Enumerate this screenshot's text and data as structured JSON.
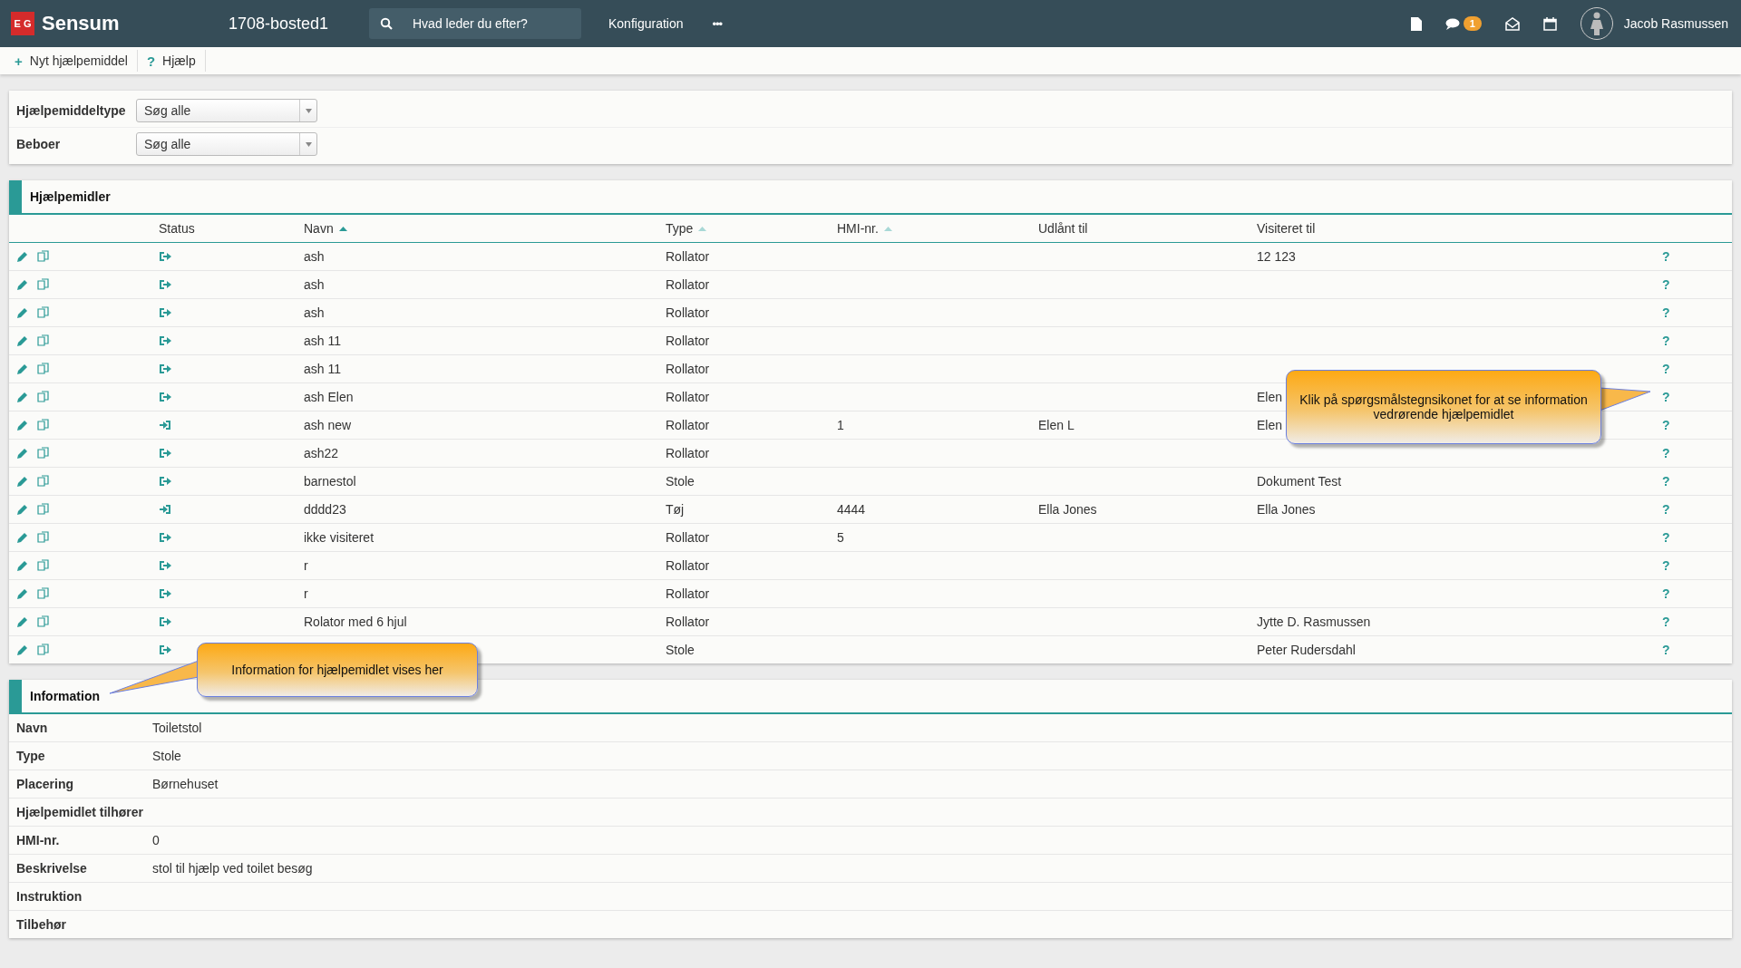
{
  "topbar": {
    "logo": "E G",
    "brand": "Sensum",
    "site": "1708-bosted1",
    "search": {
      "placeholder": "Hvad leder du efter?"
    },
    "menu": [
      "Konfiguration"
    ],
    "more": "•••",
    "chat_badge": "1",
    "user": "Jacob Rasmussen"
  },
  "toolbar": [
    {
      "icon": "+",
      "label": "Nyt hjælpemiddel"
    },
    {
      "icon": "?",
      "label": "Hjælp"
    }
  ],
  "filters": [
    {
      "label": "Hjælpemiddeltype",
      "value": "Søg alle"
    },
    {
      "label": "Beboer",
      "value": "Søg alle"
    }
  ],
  "aids": {
    "title": "Hjælpemidler",
    "columns": [
      {
        "label": "Status"
      },
      {
        "label": "Navn",
        "sorted": true
      },
      {
        "label": "Type",
        "sorted": false
      },
      {
        "label": "HMI-nr.",
        "sorted": false
      },
      {
        "label": "Udlånt til"
      },
      {
        "label": "Visiteret til"
      }
    ],
    "help": "?",
    "rows": [
      {
        "kind": "out",
        "name": "ash",
        "type": "Rollator",
        "assigned": "12 123"
      },
      {
        "kind": "out",
        "name": "ash",
        "type": "Rollator"
      },
      {
        "kind": "out",
        "name": "ash",
        "type": "Rollator"
      },
      {
        "kind": "out",
        "name": "ash 11",
        "type": "Rollator"
      },
      {
        "kind": "out",
        "name": "ash 11",
        "type": "Rollator"
      },
      {
        "kind": "out",
        "name": "ash Elen",
        "type": "Rollator",
        "assigned": "Elen"
      },
      {
        "kind": "in",
        "name": "ash new",
        "type": "Rollator",
        "hmi": "1",
        "lent": "Elen L",
        "assigned": "Elen"
      },
      {
        "kind": "out",
        "name": "ash22",
        "type": "Rollator"
      },
      {
        "kind": "out",
        "name": "barnestol",
        "type": "Stole",
        "assigned": "Dokument Test"
      },
      {
        "kind": "in",
        "name": "dddd23",
        "type": "Tøj",
        "hmi": "4444",
        "lent": "Ella Jones",
        "assigned": "Ella Jones"
      },
      {
        "kind": "out",
        "name": "ikke visiteret",
        "type": "Rollator",
        "hmi": "5"
      },
      {
        "kind": "out",
        "name": "r",
        "type": "Rollator"
      },
      {
        "kind": "out",
        "name": "r",
        "type": "Rollator"
      },
      {
        "kind": "out",
        "name": "Rolator med 6 hjul",
        "type": "Rollator",
        "assigned": "Jytte D. Rasmussen"
      },
      {
        "kind": "out",
        "type": "Stole",
        "assigned": "Peter Rudersdahl"
      }
    ]
  },
  "information": {
    "title": "Information",
    "fields": [
      {
        "label": "Navn",
        "value": "Toiletstol"
      },
      {
        "label": "Type",
        "value": "Stole"
      },
      {
        "label": "Placering",
        "value": "Børnehuset"
      },
      {
        "label": "Hjælpemidlet tilhører"
      },
      {
        "label": "HMI-nr.",
        "value": "0"
      },
      {
        "label": "Beskrivelse",
        "value": "stol til hjælp ved toilet besøg"
      },
      {
        "label": "Instruktion"
      },
      {
        "label": "Tilbehør"
      }
    ]
  },
  "callouts": [
    {
      "kind": "table",
      "text": "Klik på spørgsmålstegnsikonet for at se information vedrørende hjælpemidlet"
    },
    {
      "kind": "info",
      "text": "Information for hjælpemidlet vises her"
    }
  ]
}
